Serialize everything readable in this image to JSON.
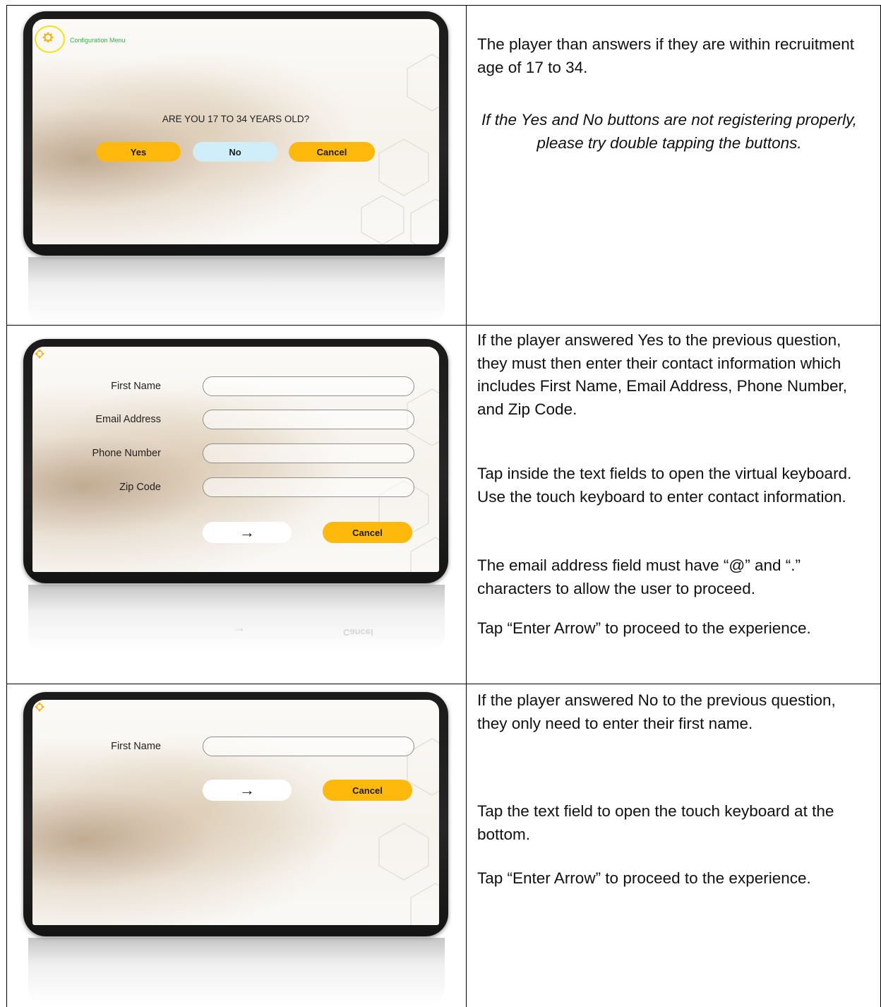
{
  "rows": [
    {
      "screen": {
        "config_label": "Configuration Menu",
        "question": "ARE YOU 17 TO 34 YEARS OLD?",
        "buttons": {
          "yes": "Yes",
          "no": "No",
          "cancel": "Cancel"
        }
      },
      "text": {
        "p1": "The player than answers if they are within recruitment age of 17 to 34.",
        "p2": "If the Yes and No buttons are not registering properly, please try double tapping the buttons."
      }
    },
    {
      "screen": {
        "labels": {
          "first_name": "First Name",
          "email": "Email Address",
          "phone": "Phone Number",
          "zip": "Zip Code"
        },
        "fields": {
          "first_name": "",
          "email": "",
          "phone": "",
          "zip": ""
        },
        "enter_arrow": "→",
        "cancel": "Cancel",
        "reflection": {
          "arrow": "→",
          "cancel": "Cancel"
        }
      },
      "text": {
        "p1": "If the player answered Yes to the previous question, they must then enter their contact information which includes First Name, Email Address, Phone Number, and Zip Code.",
        "p2": "Tap inside the text fields to open the virtual keyboard. Use the touch keyboard to enter contact information.",
        "p3": "The email address field must have “@” and “.” characters to allow the user to proceed.",
        "p4": "Tap “Enter Arrow” to proceed to the experience."
      }
    },
    {
      "screen": {
        "labels": {
          "first_name": "First Name"
        },
        "fields": {
          "first_name": ""
        },
        "enter_arrow": "→",
        "cancel": "Cancel"
      },
      "text": {
        "p1": "If the player answered No to the previous question, they only need to enter their first name.",
        "p2": "Tap the text field to open the touch keyboard at the bottom.",
        "p3": "Tap “Enter Arrow” to proceed to the experience."
      }
    }
  ],
  "colors": {
    "accent_yellow": "#ffb80c",
    "no_button_blue": "#cfeefa",
    "config_text_green": "#35b54a",
    "highlight_ring": "#f2e312",
    "gear": "#f5b319"
  },
  "icons": [
    "gear-icon",
    "right-arrow-icon"
  ]
}
